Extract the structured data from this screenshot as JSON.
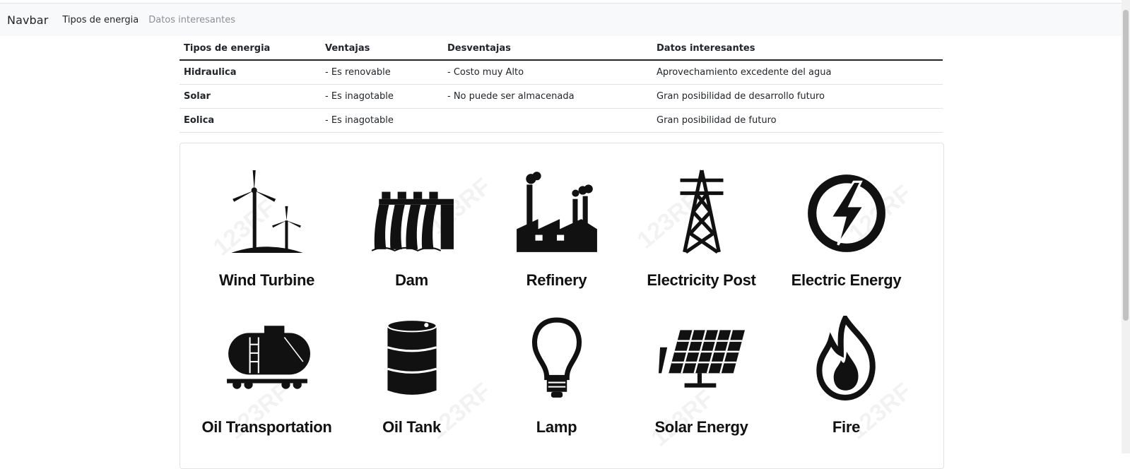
{
  "navbar": {
    "brand": "Navbar",
    "links": [
      {
        "label": "Tipos de energia",
        "active": true
      },
      {
        "label": "Datos interesantes",
        "active": false
      }
    ]
  },
  "table": {
    "headers": [
      "Tipos de energia",
      "Ventajas",
      "Desventajas",
      "Datos interesantes"
    ],
    "rows": [
      {
        "name": "Hidraulica",
        "ventajas": "- Es renovable",
        "desventajas": "- Costo muy Alto",
        "datos": "Aprovechamiento excedente del agua"
      },
      {
        "name": "Solar",
        "ventajas": "- Es inagotable",
        "desventajas": "- No puede ser almacenada",
        "datos": "Gran posibilidad de desarrollo futuro"
      },
      {
        "name": "Eolica",
        "ventajas": "- Es inagotable",
        "desventajas": "",
        "datos": "Gran posibilidad de futuro"
      }
    ]
  },
  "image": {
    "watermark": "123RF",
    "icons": [
      {
        "label": "Wind Turbine",
        "icon": "wind-turbine-icon"
      },
      {
        "label": "Dam",
        "icon": "dam-icon"
      },
      {
        "label": "Refinery",
        "icon": "refinery-icon"
      },
      {
        "label": "Electricity Post",
        "icon": "electricity-post-icon"
      },
      {
        "label": "Electric Energy",
        "icon": "electric-energy-icon"
      },
      {
        "label": "Oil Transportation",
        "icon": "oil-transportation-icon"
      },
      {
        "label": "Oil Tank",
        "icon": "oil-tank-icon"
      },
      {
        "label": "Lamp",
        "icon": "lamp-icon"
      },
      {
        "label": "Solar Energy",
        "icon": "solar-energy-icon"
      },
      {
        "label": "Fire",
        "icon": "fire-icon"
      }
    ]
  }
}
